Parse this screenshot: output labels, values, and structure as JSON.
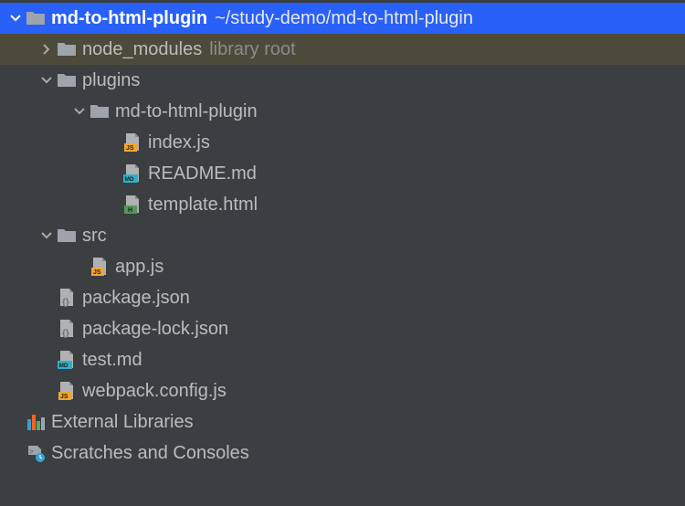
{
  "tree": {
    "root": {
      "name": "md-to-html-plugin",
      "path": "~/study-demo/md-to-html-plugin"
    },
    "nodeModules": {
      "name": "node_modules",
      "hint": "library root"
    },
    "plugins": {
      "name": "plugins",
      "mdToHtml": {
        "name": "md-to-html-plugin",
        "files": {
          "indexJs": "index.js",
          "readmeMd": "README.md",
          "templateHtml": "template.html"
        }
      }
    },
    "src": {
      "name": "src",
      "files": {
        "appJs": "app.js"
      }
    },
    "files": {
      "packageJson": "package.json",
      "packageLockJson": "package-lock.json",
      "testMd": "test.md",
      "webpackConfigJs": "webpack.config.js"
    },
    "externalLibraries": "External Libraries",
    "scratches": "Scratches and Consoles"
  }
}
